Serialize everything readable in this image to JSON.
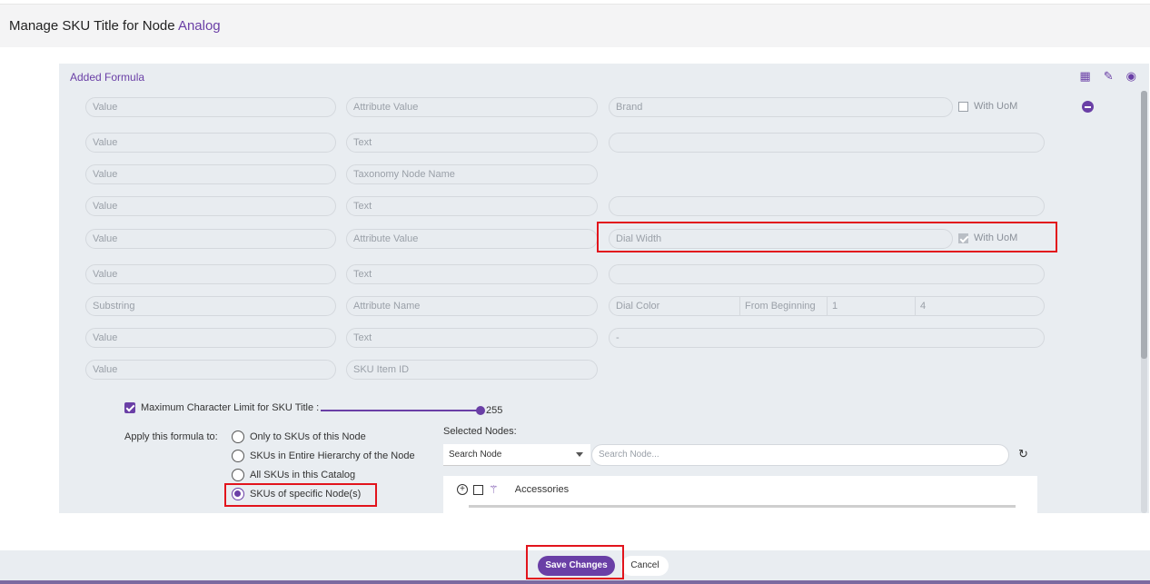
{
  "header": {
    "title_prefix": "Manage SKU Title for Node",
    "node_name": "Analog"
  },
  "panel": {
    "title": "Added Formula",
    "icons": [
      "delete-list-icon",
      "edit-icon",
      "eye-icon"
    ]
  },
  "rows": [
    {
      "type": "Value",
      "source": "Attribute Value",
      "value": "Brand",
      "uom_label": "With UoM",
      "uom_checked": false
    },
    {
      "type": "Value",
      "source": "Text",
      "value": ""
    },
    {
      "type": "Value",
      "source": "Taxonomy Node Name"
    },
    {
      "type": "Value",
      "source": "Text",
      "value": ""
    },
    {
      "type": "Value",
      "source": "Attribute Value",
      "value": "Dial Width",
      "uom_label": "With UoM",
      "uom_checked": true
    },
    {
      "type": "Value",
      "source": "Text",
      "value": ""
    },
    {
      "type": "Substring",
      "source": "Attribute Name",
      "value": "Dial Color",
      "from": "From Beginning",
      "start": "1",
      "length": "4"
    },
    {
      "type": "Value",
      "source": "Text",
      "value": "-"
    },
    {
      "type": "Value",
      "source": "SKU Item ID"
    }
  ],
  "max_limit": {
    "label": "Maximum Character Limit for SKU Title :",
    "value": "255",
    "checked": true
  },
  "apply": {
    "label": "Apply this formula to:",
    "options": [
      "Only to SKUs of this Node",
      "SKUs in Entire Hierarchy of the Node",
      "All SKUs in this Catalog",
      "SKUs of specific Node(s)"
    ],
    "selected_index": 3
  },
  "selected_nodes": {
    "label": "Selected Nodes:",
    "select_value": "Search Node",
    "search_placeholder": "Search Node...",
    "tree": [
      {
        "label": "Accessories"
      }
    ]
  },
  "footer": {
    "save_label": "Save Changes",
    "cancel_label": "Cancel"
  },
  "colors": {
    "accent": "#6a3fa6",
    "highlight": "#e2141c",
    "panel_bg": "#e9edf1"
  }
}
